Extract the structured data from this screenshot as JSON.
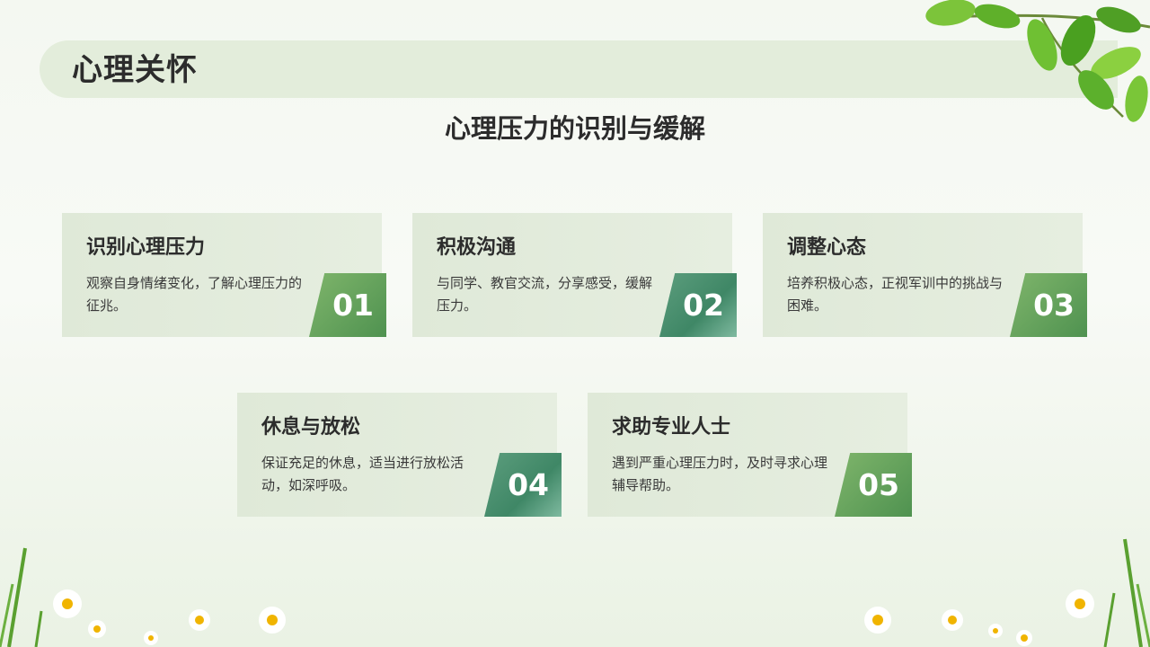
{
  "header": {
    "section_title": "心理关怀"
  },
  "slide": {
    "title": "心理压力的识别与缓解"
  },
  "cards": [
    {
      "title": "识别心理压力",
      "desc": "观察自身情绪变化，了解心理压力的征兆。",
      "number": "01"
    },
    {
      "title": "积极沟通",
      "desc": "与同学、教官交流，分享感受，缓解压力。",
      "number": "02"
    },
    {
      "title": "调整心态",
      "desc": "培养积极心态，正视军训中的挑战与困难。",
      "number": "03"
    },
    {
      "title": "休息与放松",
      "desc": "保证充足的休息，适当进行放松活动，如深呼吸。",
      "number": "04"
    },
    {
      "title": "求助专业人士",
      "desc": "遇到严重心理压力时，及时寻求心理辅导帮助。",
      "number": "05"
    }
  ],
  "decor": {
    "leaf_icon": "green-leaves",
    "flower_icon": "daisy-flowers"
  },
  "colors": {
    "accent_green": "#5a9a5a",
    "teal_green": "#3f8766",
    "card_bg": "#e3ecdc"
  }
}
